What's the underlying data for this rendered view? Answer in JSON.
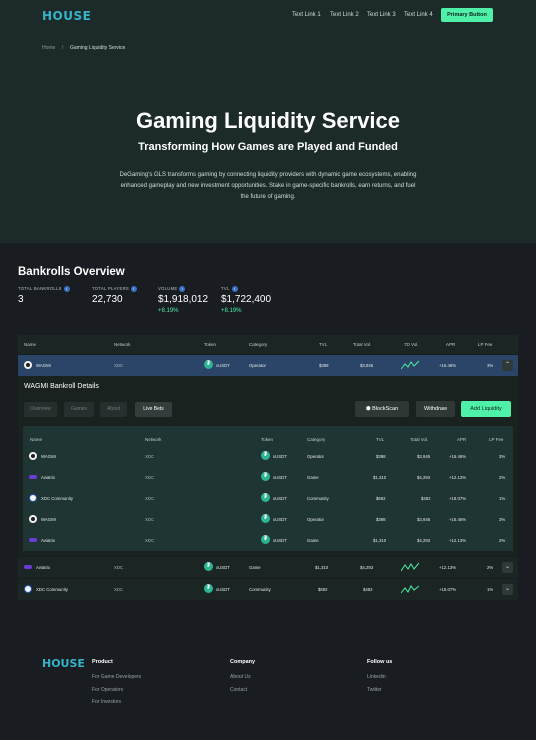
{
  "header": {
    "logo": "HOUSE",
    "nav": [
      "Text Link 1",
      "Text Link 2",
      "Text Link 3",
      "Text Link 4"
    ],
    "primary_button": "Primary Button"
  },
  "breadcrumb": {
    "home": "Home",
    "separator": "/",
    "current": "Gaming Liquidity Service"
  },
  "hero": {
    "title": "Gaming Liquidity Service",
    "subtitle": "Transforming How Games are Played and Funded",
    "description": "DeGaming's GLS transforms gaming by connecting liquidity providers with dynamic game ecosystems, enabling enhanced gameplay and new investment opportunities. Stake in game-specific bankrolls, earn returns, and fuel the future of gaming."
  },
  "overview": {
    "title": "Bankrolls Overview",
    "stats": [
      {
        "label": "TOTAL BANKROLLS",
        "value": "3",
        "change": ""
      },
      {
        "label": "TOTAL PLAYERS",
        "value": "22,730",
        "change": ""
      },
      {
        "label": "VOLUME",
        "value": "$1,918,012",
        "change": "+8.19%"
      },
      {
        "label": "TVL",
        "value": "$1,722,400",
        "change": "+8.19%"
      }
    ]
  },
  "table": {
    "headers": [
      "Name",
      "Network",
      "Token",
      "Category",
      "TVL",
      "Total Vol.",
      "7D Vol.",
      "APR",
      "LP Fee"
    ],
    "rows": [
      {
        "name": "WAGMI",
        "network": "XDC",
        "token": "xUSDT",
        "category": "Operator",
        "tvl": "$398",
        "total_vol": "$3,945",
        "apr": "+16.46%",
        "lp_fee": "3%",
        "avatar": "wagmi-avatar-icon",
        "chevron": "chevron-up-icon"
      },
      {
        "name": "Aviatrix",
        "network": "XDC",
        "token": "xUSDT",
        "category": "Game",
        "tvl": "$1,310",
        "total_vol": "$4,293",
        "apr": "+12.13%",
        "lp_fee": "2%",
        "avatar": "aviatrix-avatar-icon",
        "chevron": "chevron-down-icon"
      },
      {
        "name": "XDC Community",
        "network": "XDC",
        "token": "xUSDT",
        "category": "Community",
        "tvl": "$692",
        "total_vol": "$482",
        "apr": "+18.07%",
        "lp_fee": "1%",
        "avatar": "xdc-avatar-icon",
        "chevron": "chevron-down-icon"
      }
    ]
  },
  "detail": {
    "title": "WAGMI Bankroll Details",
    "tabs": [
      "Overview",
      "Games",
      "About",
      "Live Bets"
    ],
    "buttons": {
      "blockscan": "BlockScan",
      "withdraw": "Withdraw",
      "add_liquidity": "Add Liquidity"
    },
    "headers": [
      "Name",
      "Network",
      "Token",
      "Category",
      "TVL",
      "Total Vol.",
      "APR",
      "LP Fee"
    ],
    "rows": [
      {
        "name": "WAGMI",
        "network": "XDC",
        "token": "xUSDT",
        "category": "Operator",
        "tvl": "$398",
        "total_vol": "$3,945",
        "apr": "+16.46%",
        "lp_fee": "3%",
        "avatar": "wagmi-avatar-icon"
      },
      {
        "name": "Aviatrix",
        "network": "XDC",
        "token": "xUSDT",
        "category": "Game",
        "tvl": "$1,310",
        "total_vol": "$4,293",
        "apr": "+12.13%",
        "lp_fee": "2%",
        "avatar": "aviatrix-avatar-icon"
      },
      {
        "name": "XDC Community",
        "network": "XDC",
        "token": "xUSDT",
        "category": "Community",
        "tvl": "$692",
        "total_vol": "$482",
        "apr": "+18.07%",
        "lp_fee": "1%",
        "avatar": "xdc-avatar-icon"
      },
      {
        "name": "WAGMI",
        "network": "XDC",
        "token": "xUSDT",
        "category": "Operator",
        "tvl": "$398",
        "total_vol": "$3,945",
        "apr": "+16.46%",
        "lp_fee": "3%",
        "avatar": "wagmi-avatar-icon"
      },
      {
        "name": "Aviatrix",
        "network": "XDC",
        "token": "xUSDT",
        "category": "Game",
        "tvl": "$1,310",
        "total_vol": "$4,293",
        "apr": "+12.13%",
        "lp_fee": "2%",
        "avatar": "aviatrix-avatar-icon"
      }
    ]
  },
  "footer": {
    "logo": "HOUSE",
    "columns": [
      {
        "title": "Product",
        "links": [
          "For Game Developers",
          "For Operators",
          "For Investors"
        ]
      },
      {
        "title": "Company",
        "links": [
          "About Us",
          "Contact"
        ]
      },
      {
        "title": "Follow us",
        "links": [
          "Linkedin",
          "Twitter"
        ]
      }
    ]
  },
  "colors": {
    "accent": "#4ff0a8",
    "hero_bg": "#1c2b29",
    "page_bg": "#191c20",
    "selected_row": "#2a4568",
    "info": "#3b71c4"
  }
}
